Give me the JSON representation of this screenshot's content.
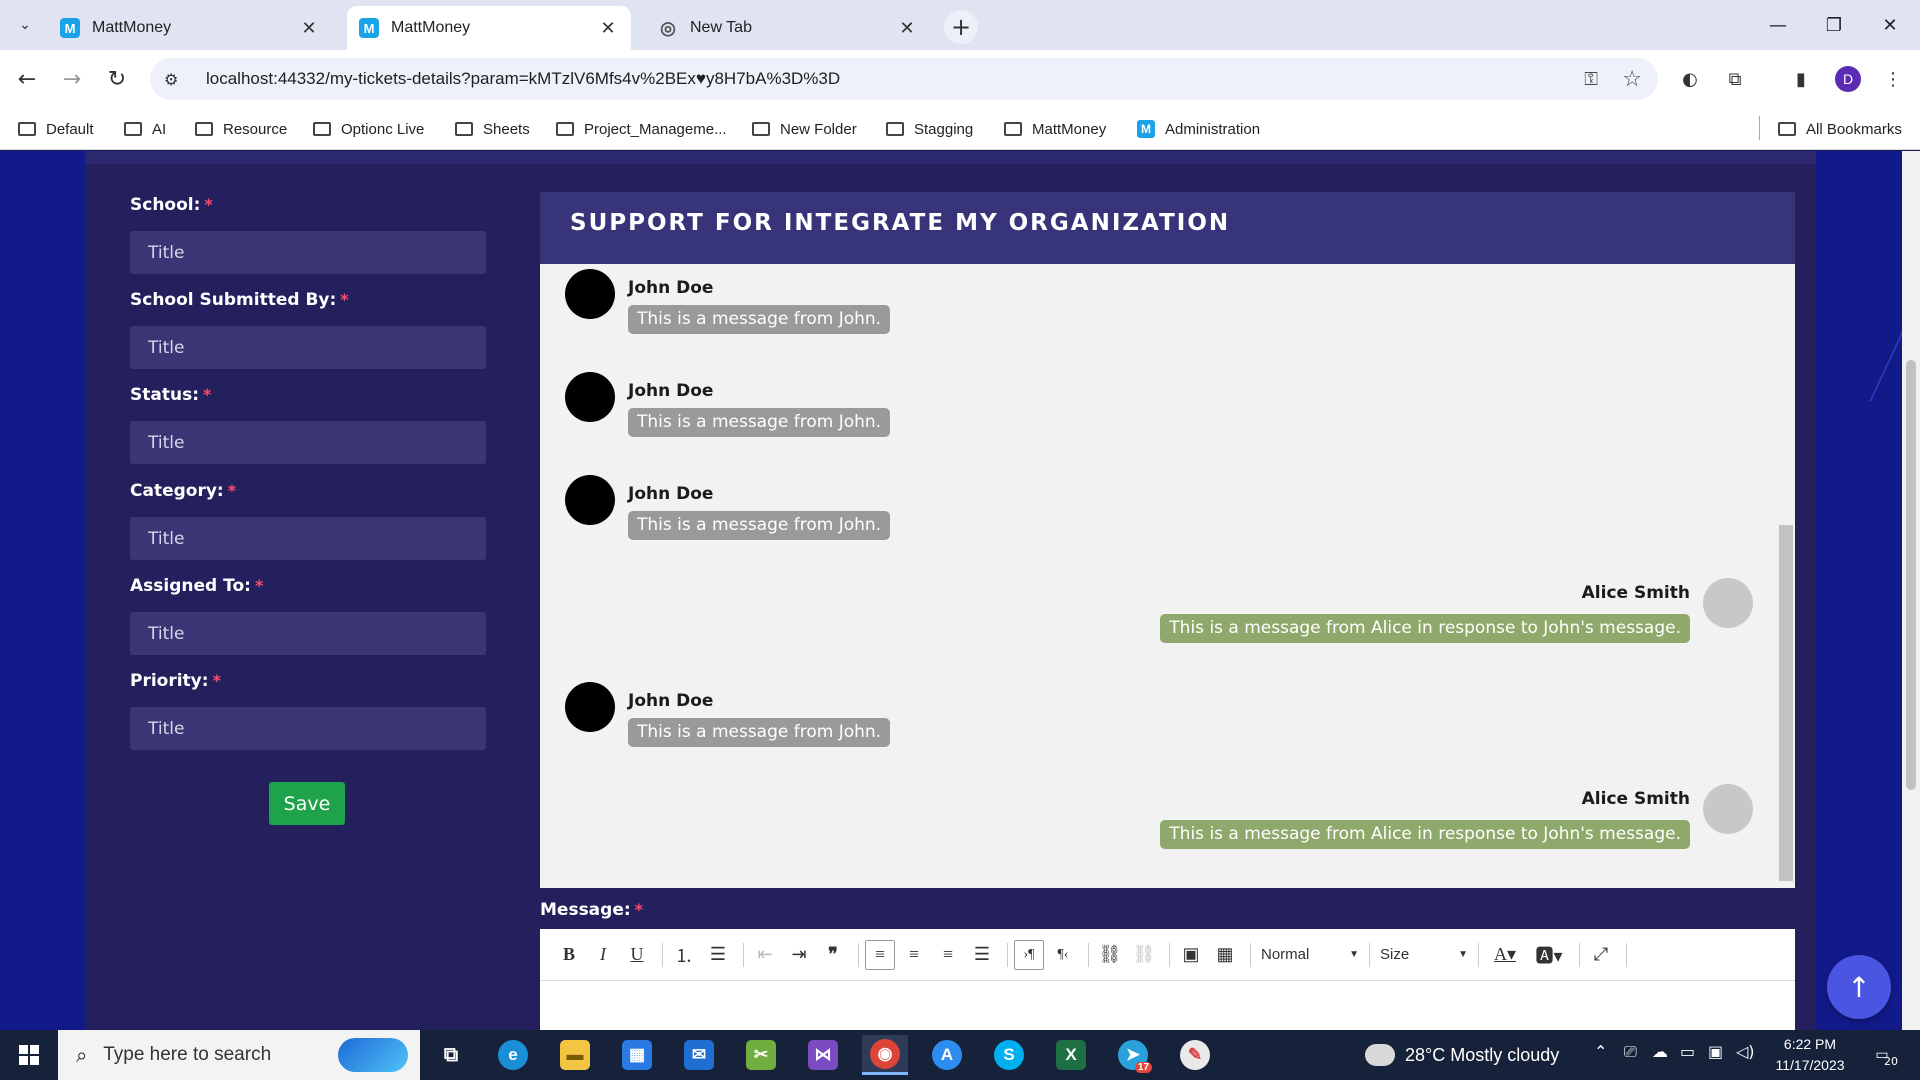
{
  "browser": {
    "tabs": [
      {
        "title": "MattMoney",
        "favicon": "mattmoney-favicon",
        "active": false
      },
      {
        "title": "MattMoney",
        "favicon": "mattmoney-favicon",
        "active": true
      },
      {
        "title": "New Tab",
        "favicon": "chrome-favicon",
        "active": false
      }
    ],
    "url": "localhost:44332/my-tickets-details?param=kMTzlV6Mfs4v%2BEx♥y8H7bA%3D%3D",
    "profile_initial": "D",
    "bookmarks": [
      "Default",
      "AI",
      "Resource",
      "Optionc Live",
      "Sheets",
      "Project_Manageme...",
      "New Folder",
      "Stagging",
      "MattMoney",
      "Administration"
    ],
    "all_bookmarks": "All Bookmarks"
  },
  "form": {
    "fields": [
      {
        "label": "School:",
        "placeholder": "Title"
      },
      {
        "label": "School Submitted By:",
        "placeholder": "Title"
      },
      {
        "label": "Status:",
        "placeholder": "Title"
      },
      {
        "label": "Category:",
        "placeholder": "Title"
      },
      {
        "label": "Assigned To:",
        "placeholder": "Title"
      },
      {
        "label": "Priority:",
        "placeholder": "Title"
      }
    ],
    "required_mark": "*",
    "save_label": "Save"
  },
  "chat": {
    "title": "SUPPORT FOR INTEGRATE MY ORGANIZATION",
    "messages": [
      {
        "sender": "John Doe",
        "text": "This is a message from John.",
        "side": "left"
      },
      {
        "sender": "John Doe",
        "text": "This is a message from John.",
        "side": "left"
      },
      {
        "sender": "John Doe",
        "text": "This is a message from John.",
        "side": "left"
      },
      {
        "sender": "Alice Smith",
        "text": "This is a message from Alice in response to John's message.",
        "side": "right"
      },
      {
        "sender": "John Doe",
        "text": "This is a message from John.",
        "side": "left"
      },
      {
        "sender": "Alice Smith",
        "text": "This is a message from Alice in response to John's message.",
        "side": "right"
      }
    ]
  },
  "editor": {
    "label": "Message:",
    "format_select": "Normal",
    "size_select": "Size",
    "buttons": {
      "bold": "B",
      "italic": "I",
      "underline": "U",
      "quote": "❞",
      "ltr": "›¶",
      "rtl": "¶‹"
    }
  },
  "taskbar": {
    "search_placeholder": "Type here to search",
    "weather": "28°C  Mostly cloudy",
    "time": "6:22 PM",
    "date": "11/17/2023",
    "notification_count": "20",
    "telegram_badge": "17"
  },
  "colors": {
    "page_bg": "#121a8a",
    "panel_bg": "#24205e",
    "input_bg": "#3a3675",
    "save_button": "#1fa34a",
    "john_bubble": "#9a9a9a",
    "alice_bubble": "#8fa86b",
    "required": "#ff4b6e",
    "fab": "#4a56e2"
  }
}
